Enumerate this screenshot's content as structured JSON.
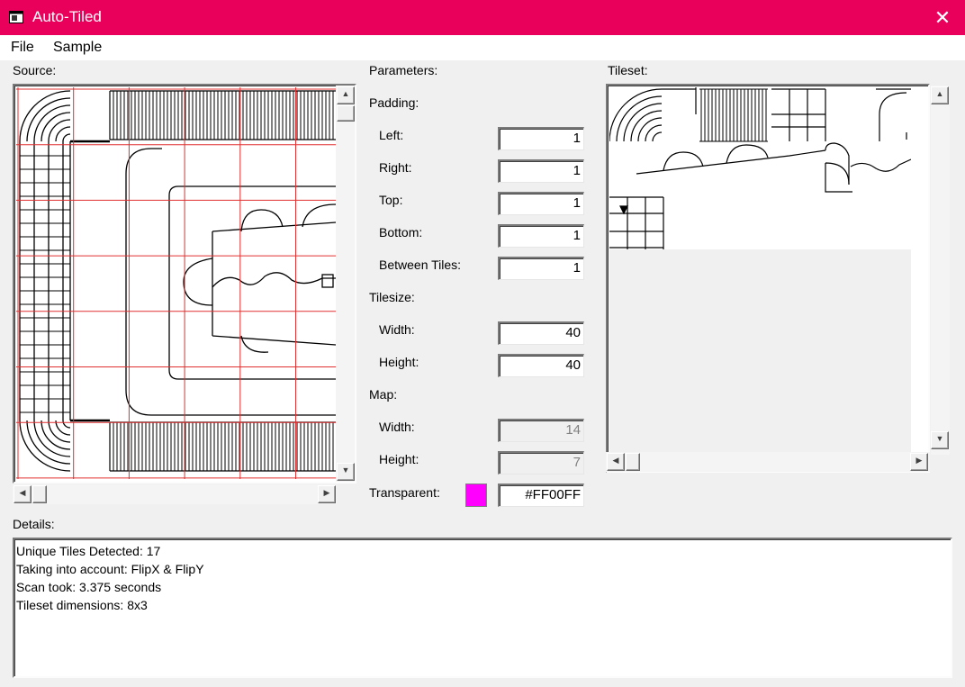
{
  "window": {
    "title": "Auto-Tiled",
    "close_glyph": "✕",
    "icon": "app-window-icon"
  },
  "menu": [
    "File",
    "Sample"
  ],
  "source": {
    "label": "Source:"
  },
  "tileset": {
    "label": "Tileset:"
  },
  "params": {
    "heading": "Parameters:",
    "padding_heading": "Padding:",
    "padding": [
      {
        "label": "Left:",
        "value": "1"
      },
      {
        "label": "Right:",
        "value": "1"
      },
      {
        "label": "Top:",
        "value": "1"
      },
      {
        "label": "Bottom:",
        "value": "1"
      },
      {
        "label": "Between Tiles:",
        "value": "1"
      }
    ],
    "tilesize_heading": "Tilesize:",
    "tilesize": [
      {
        "label": "Width:",
        "value": "40"
      },
      {
        "label": "Height:",
        "value": "40"
      }
    ],
    "map_heading": "Map:",
    "map": [
      {
        "label": "Width:",
        "value": "14"
      },
      {
        "label": "Height:",
        "value": "7"
      }
    ],
    "transparent_label": "Transparent:",
    "transparent_value": "#FF00FF",
    "transparent_color": "#FF00FF"
  },
  "details": {
    "label": "Details:",
    "lines": [
      "Unique Tiles Detected: 17",
      "Taking into account: FlipX & FlipY",
      "Scan took: 3.375 seconds",
      "Tileset dimensions: 8x3"
    ]
  },
  "colors": {
    "titlebar": "#e8005a",
    "grid": "#e03030",
    "window_bg": "#f0f0f0"
  }
}
